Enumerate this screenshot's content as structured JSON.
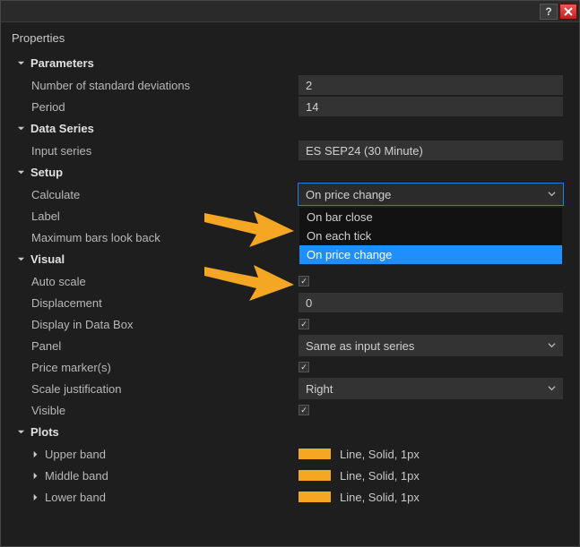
{
  "titlebar": {
    "help": "?",
    "close": "X"
  },
  "header": {
    "title": "Properties"
  },
  "sections": {
    "parameters": {
      "label": "Parameters",
      "num_std": {
        "label": "Number of standard deviations",
        "value": "2"
      },
      "period": {
        "label": "Period",
        "value": "14"
      }
    },
    "data_series": {
      "label": "Data Series",
      "input_series": {
        "label": "Input series",
        "value": "ES SEP24 (30 Minute)"
      }
    },
    "setup": {
      "label": "Setup",
      "calculate": {
        "label": "Calculate",
        "value": "On price change",
        "options": [
          "On bar close",
          "On each tick",
          "On price change"
        ]
      },
      "label_field": {
        "label": "Label"
      },
      "max_bars": {
        "label": "Maximum bars look back"
      }
    },
    "visual": {
      "label": "Visual",
      "auto_scale": {
        "label": "Auto scale",
        "checked": true
      },
      "displacement": {
        "label": "Displacement",
        "value": "0"
      },
      "display_databox": {
        "label": "Display in Data Box",
        "checked": true
      },
      "panel": {
        "label": "Panel",
        "value": "Same as input series"
      },
      "price_markers": {
        "label": "Price marker(s)",
        "checked": true
      },
      "scale_just": {
        "label": "Scale justification",
        "value": "Right"
      },
      "visible": {
        "label": "Visible",
        "checked": true
      }
    },
    "plots": {
      "label": "Plots",
      "upper": {
        "label": "Upper band",
        "desc": "Line, Solid, 1px"
      },
      "middle": {
        "label": "Middle band",
        "desc": "Line, Solid, 1px"
      },
      "lower": {
        "label": "Lower band",
        "desc": "Line, Solid, 1px"
      }
    }
  },
  "colors": {
    "swatch": "#f5a623",
    "highlight": "#1f8fff",
    "arrow": "#f5a623"
  }
}
